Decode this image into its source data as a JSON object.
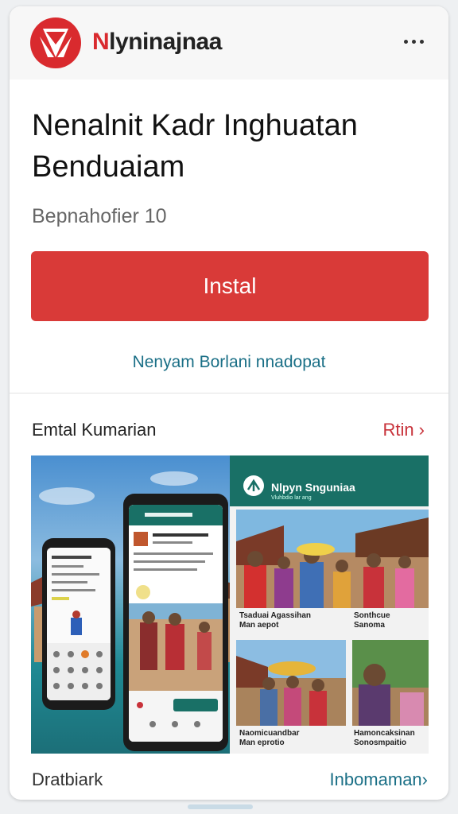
{
  "header": {
    "brand_first": "N",
    "brand_rest": "lyninajnaa",
    "logo_icon": "app-logo-icon",
    "more_icon": "more-dots-icon"
  },
  "app": {
    "title_line1": "Nenalnit Kadr Inghuatan",
    "title_line2": "Benduaiam",
    "subtitle": "Bepnahofier 10",
    "install_label": "Instal",
    "secondary_link": "Nenyam Borlani nnadopat"
  },
  "screenshots": {
    "section_title": "Emtal Kumarian",
    "more_label": "Rtin ›",
    "right_app_title": "Nlpyn Snguniaa",
    "right_app_sub": "Vluhbdio lar ang"
  },
  "photos": [
    {
      "caption_1": "Tsaduai Agassihan",
      "caption_2": "Man aepot"
    },
    {
      "caption_1": "Sonthcue",
      "caption_2": "Sanoma"
    },
    {
      "caption_1": "Naomicuandbar",
      "caption_2": "Man eprotio"
    },
    {
      "caption_1": "Hamoncaksinan",
      "caption_2": "Sonosmpaitio"
    }
  ],
  "footer": {
    "left_label": "Dratbiark",
    "right_label": "Inbomaman›"
  },
  "colors": {
    "accent": "#d93a38",
    "link": "#1a6f86",
    "toolbar": "#197066"
  }
}
